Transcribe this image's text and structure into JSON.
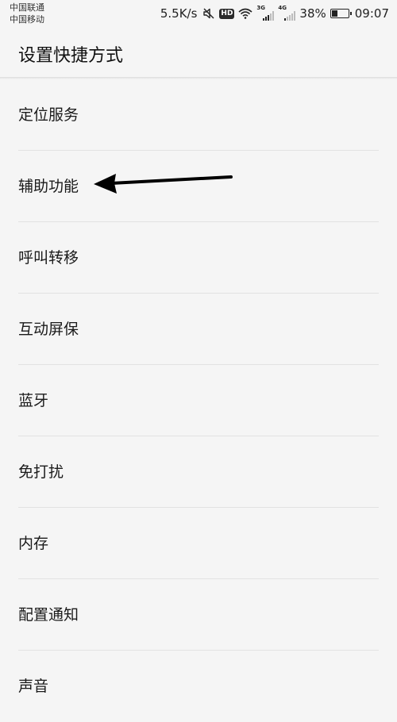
{
  "status_bar": {
    "carriers": [
      "中国联通",
      "中国移动"
    ],
    "net_speed": "5.5K/s",
    "hd_label": "HD",
    "sim1_tag": "3G",
    "sim2_tag": "4G",
    "battery_percent": "38%",
    "battery_level": 0.38,
    "time": "09:07",
    "icons": [
      "mute-icon",
      "hd-icon",
      "wifi-icon",
      "signal-3g-icon",
      "signal-4g-icon",
      "battery-icon"
    ]
  },
  "header": {
    "title": "设置快捷方式"
  },
  "settings": {
    "items": [
      {
        "label": "定位服务"
      },
      {
        "label": "辅助功能"
      },
      {
        "label": "呼叫转移"
      },
      {
        "label": "互动屏保"
      },
      {
        "label": "蓝牙"
      },
      {
        "label": "免打扰"
      },
      {
        "label": "内存"
      },
      {
        "label": "配置通知"
      },
      {
        "label": "声音"
      }
    ]
  },
  "annotation": {
    "type": "arrow",
    "points_to": "辅助功能",
    "color": "#000000"
  }
}
